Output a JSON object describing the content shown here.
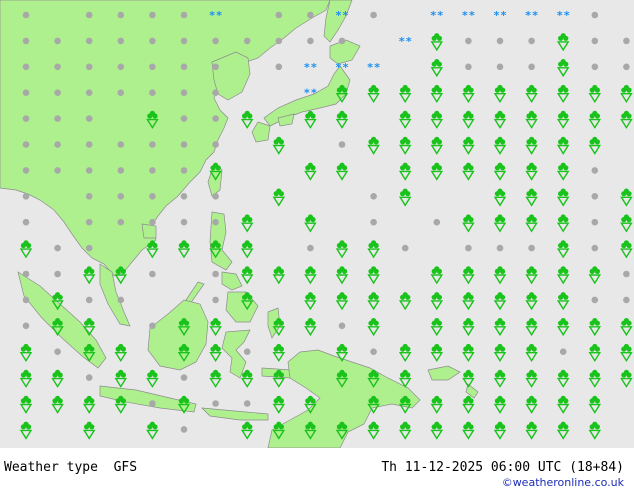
{
  "map": {
    "colors": {
      "ocean": "#e8e8e8",
      "land": "#aef08e",
      "border": "#8c8c8c",
      "cloud": "#a8a8a8",
      "rain": "#19c31b",
      "snow": "#1e8ff0"
    },
    "symbol_legend": {
      "cloud": "cloud-symbol",
      "rain": "rain-shower-symbol",
      "snow": "snow-symbol"
    },
    "grid": {
      "rows": [
        "c.ccccs.ccsc.sssssc.s.",
        "ccccccccccc.srcccrccc",
        "ccccccc.csss.rcccrcc",
        "ccccccc..srrrrrrrrrrr",
        "ccc.rccr.rr.rrrrrrrr",
        "ccccccc.r.crrrrrrrr.",
        "ccccccr..rr.rrrrrrc",
        "c.ccccc.r..cr..rrrcr",
        "c.cccccr.r.c.crrrrcr",
        "rcc.rrrr.crrc.cccrcr",
        "ccrrc.crrrrr.rrrrrrc",
        "crcc..cr.rrrrrrrrrcc",
        "crr.crr.rrcr.rrrrrrr",
        "rcrr.rrcr.rcrrrrrcrr",
        "rrcrrcrrr.rrr.rrrrrr",
        "rrrrcrccrr.rrrrrrrr",
        "r.r.rc.rrrrrrrrrrrr"
      ]
    }
  },
  "footer": {
    "left": "Weather type  GFS",
    "right": "Th 11-12-2025 06:00 UTC (18+84)",
    "credit": "©weatheronline.co.uk"
  }
}
